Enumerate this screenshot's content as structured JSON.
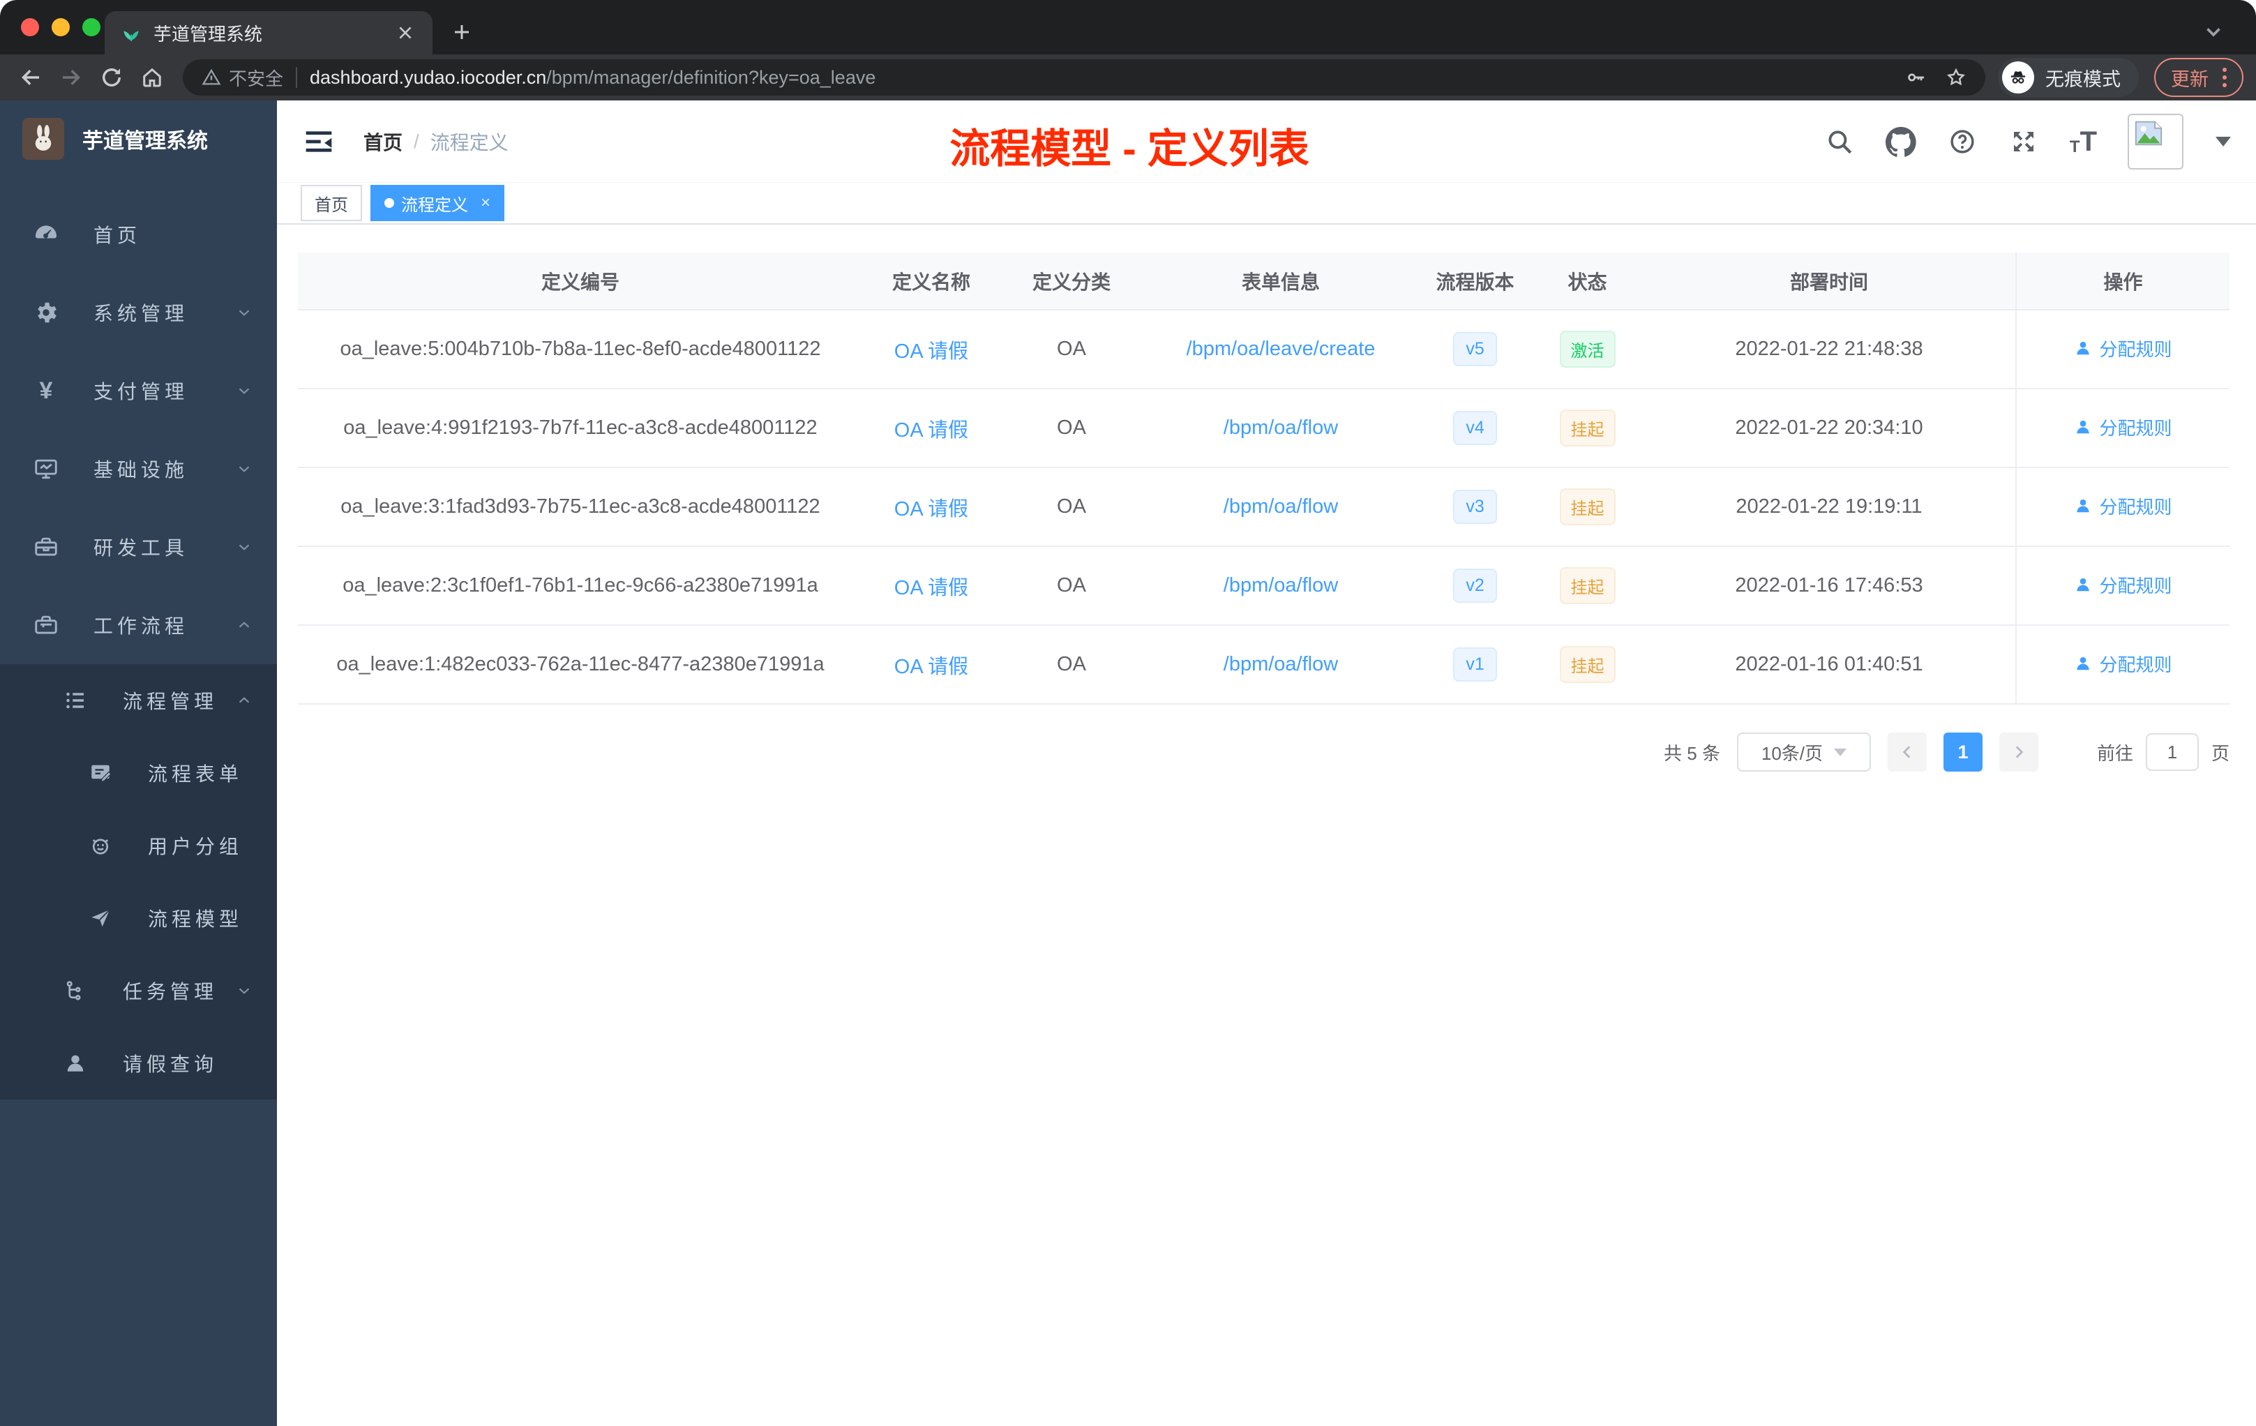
{
  "browser": {
    "tab_title": "芋道管理系统",
    "security_label": "不安全",
    "url_host": "dashboard.yudao.iocoder.cn",
    "url_path": "/bpm/manager/definition?key=oa_leave",
    "incognito_label": "无痕模式",
    "update_label": "更新"
  },
  "sidebar": {
    "title": "芋道管理系统",
    "items": [
      {
        "label": "首页"
      },
      {
        "label": "系统管理"
      },
      {
        "label": "支付管理"
      },
      {
        "label": "基础设施"
      },
      {
        "label": "研发工具"
      },
      {
        "label": "工作流程"
      },
      {
        "label": "流程管理"
      },
      {
        "label": "流程表单"
      },
      {
        "label": "用户分组"
      },
      {
        "label": "流程模型"
      },
      {
        "label": "任务管理"
      },
      {
        "label": "请假查询"
      }
    ]
  },
  "header": {
    "breadcrumb": {
      "home": "首页",
      "separator": "/",
      "current": "流程定义"
    },
    "overlay_title": "流程模型 - 定义列表"
  },
  "tags": {
    "home": "首页",
    "active": "流程定义"
  },
  "table": {
    "columns": [
      "定义编号",
      "定义名称",
      "定义分类",
      "表单信息",
      "流程版本",
      "状态",
      "部署时间",
      "操作"
    ],
    "action_label": "分配规则",
    "rows": [
      {
        "id": "oa_leave:5:004b710b-7b8a-11ec-8ef0-acde48001122",
        "name": "OA 请假",
        "category": "OA",
        "form": "/bpm/oa/leave/create",
        "version": "v5",
        "status": "激活",
        "time": "2022-01-22 21:48:38"
      },
      {
        "id": "oa_leave:4:991f2193-7b7f-11ec-a3c8-acde48001122",
        "name": "OA 请假",
        "category": "OA",
        "form": "/bpm/oa/flow",
        "version": "v4",
        "status": "挂起",
        "time": "2022-01-22 20:34:10"
      },
      {
        "id": "oa_leave:3:1fad3d93-7b75-11ec-a3c8-acde48001122",
        "name": "OA 请假",
        "category": "OA",
        "form": "/bpm/oa/flow",
        "version": "v3",
        "status": "挂起",
        "time": "2022-01-22 19:19:11"
      },
      {
        "id": "oa_leave:2:3c1f0ef1-76b1-11ec-9c66-a2380e71991a",
        "name": "OA 请假",
        "category": "OA",
        "form": "/bpm/oa/flow",
        "version": "v2",
        "status": "挂起",
        "time": "2022-01-16 17:46:53"
      },
      {
        "id": "oa_leave:1:482ec033-762a-11ec-8477-a2380e71991a",
        "name": "OA 请假",
        "category": "OA",
        "form": "/bpm/oa/flow",
        "version": "v1",
        "status": "挂起",
        "time": "2022-01-16 01:40:51"
      }
    ]
  },
  "pagination": {
    "total": "共 5 条",
    "page_size": "10条/页",
    "current_page": "1",
    "goto_label": "前往",
    "goto_value": "1",
    "page_unit": "页"
  },
  "colors": {
    "accent": "#409eff",
    "success": "#13ce66",
    "warning": "#e6a23c",
    "overlay_title_red": "#ff2b00",
    "sidebar_bg": "#304156"
  }
}
